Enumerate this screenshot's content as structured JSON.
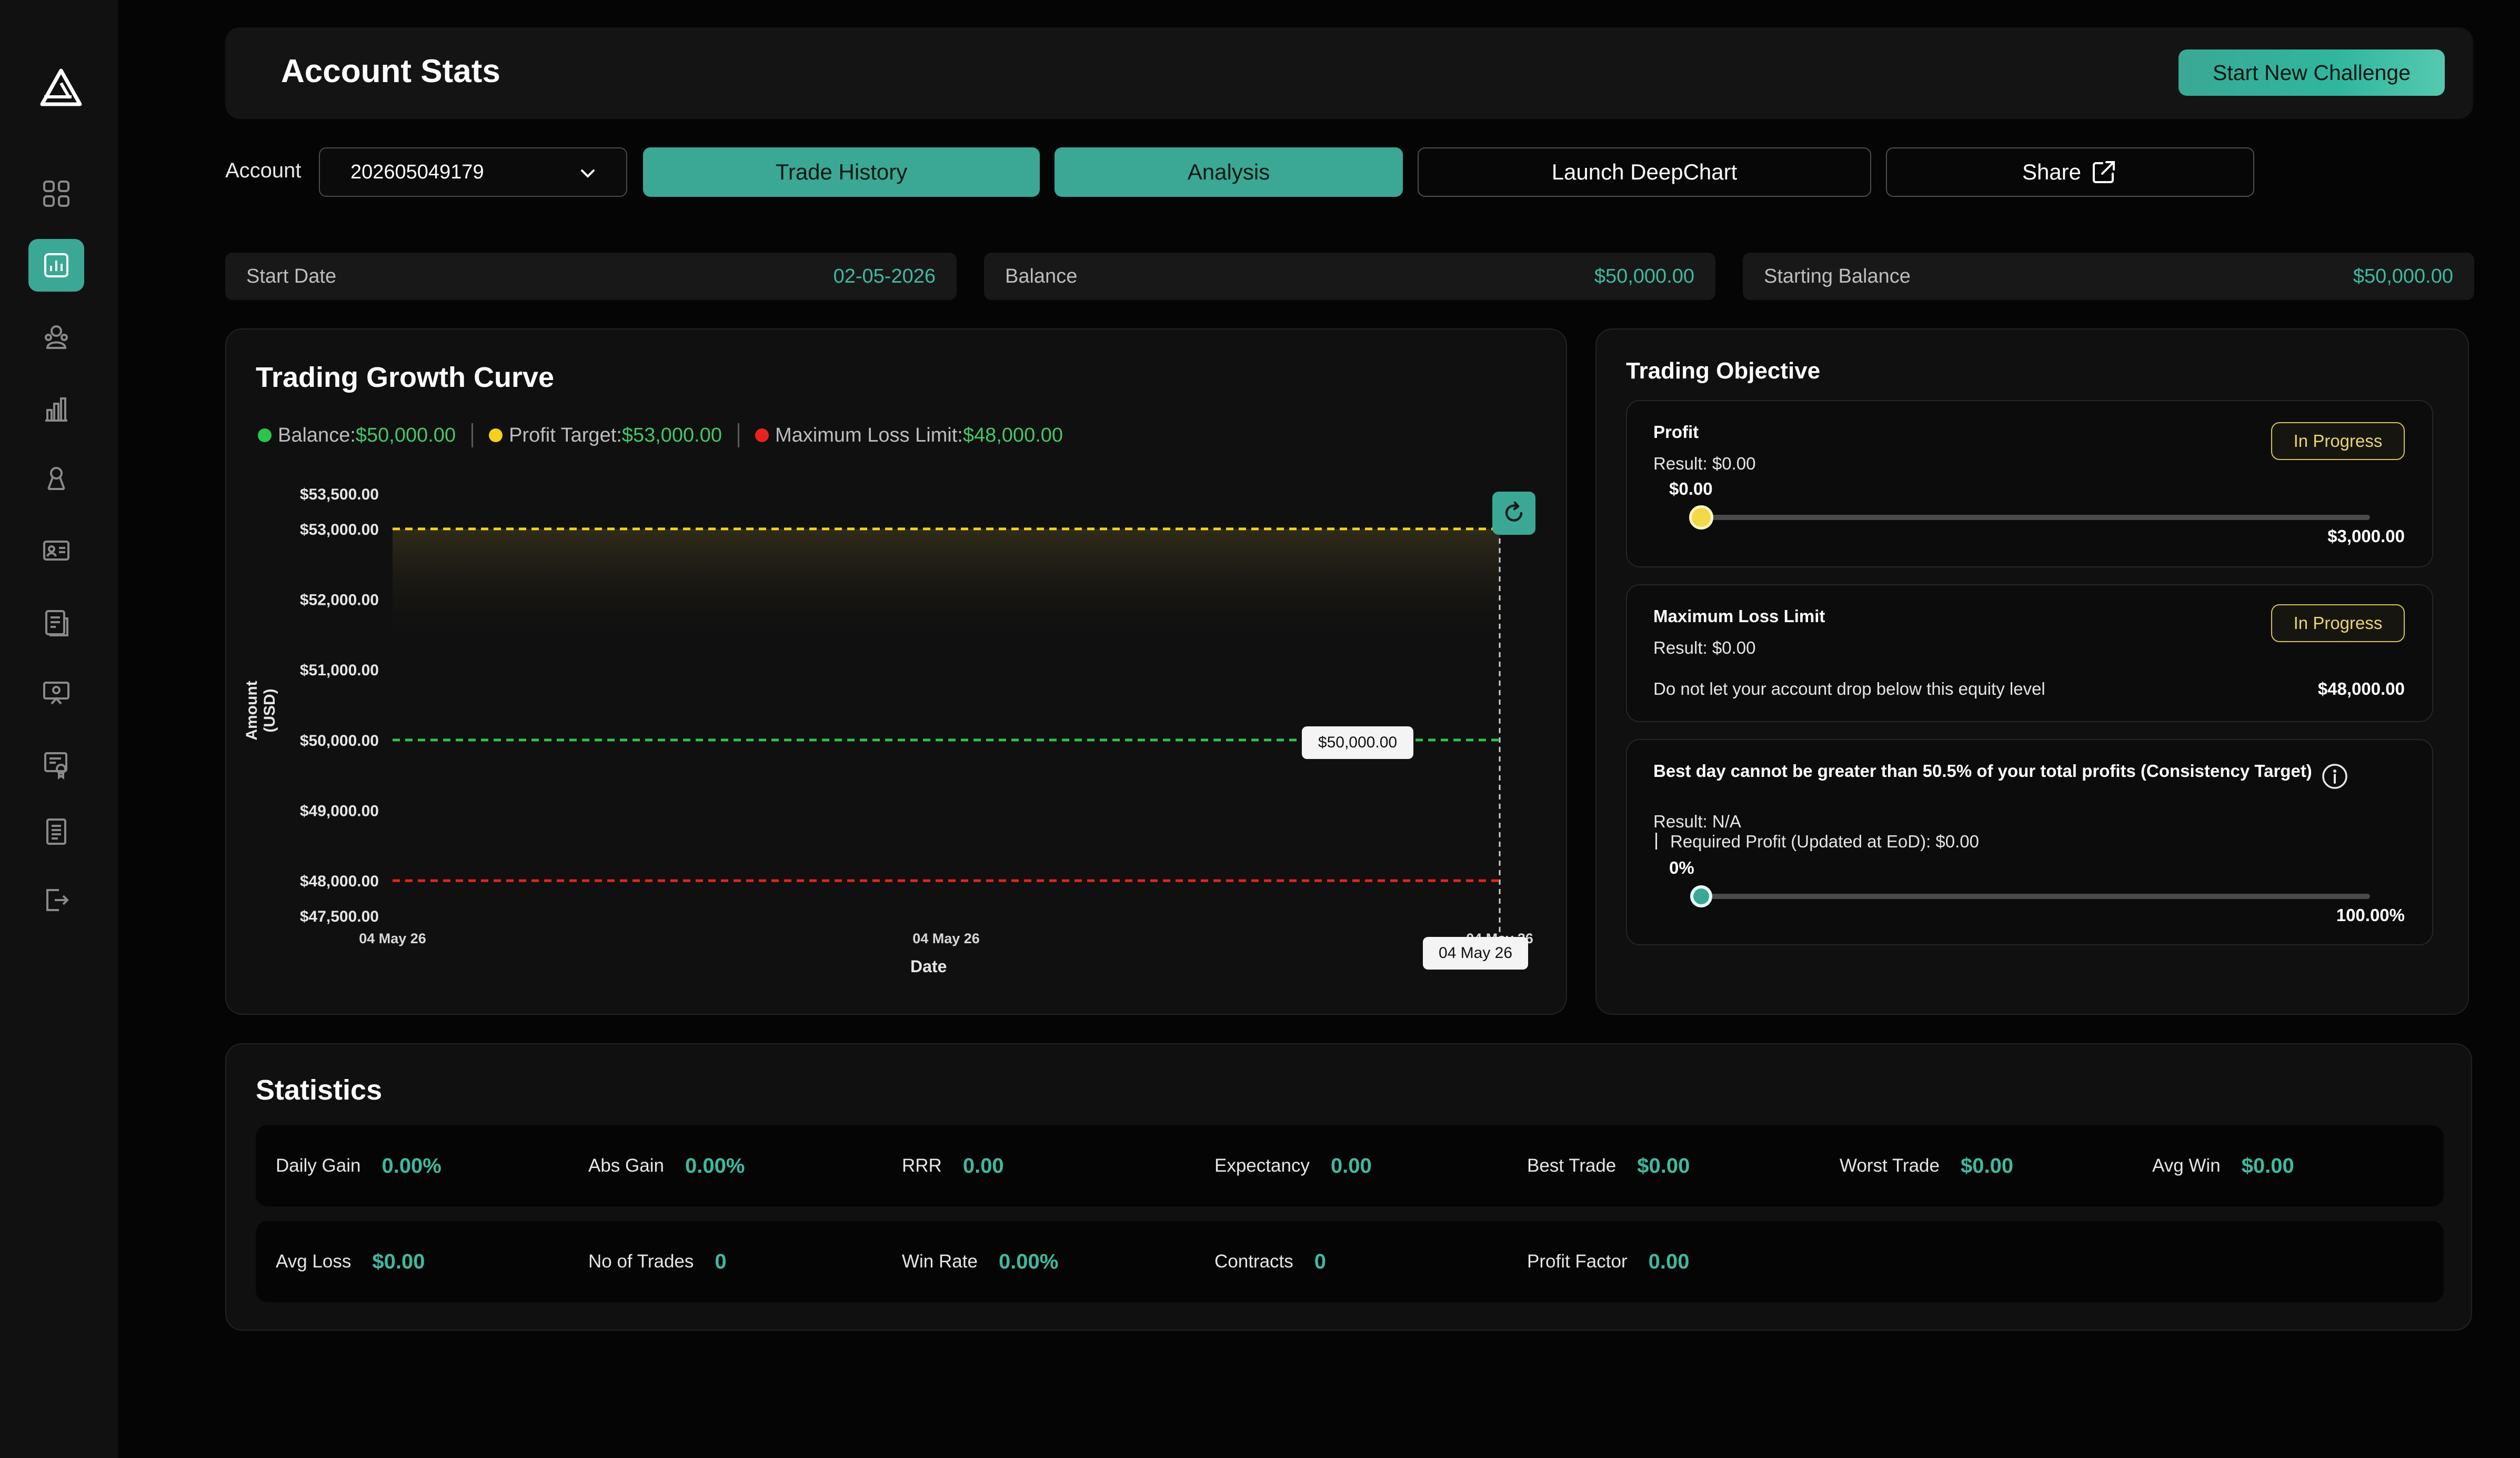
{
  "header": {
    "title": "Account Stats",
    "new_challenge_label": "Start New Challenge"
  },
  "toolbar": {
    "account_label": "Account",
    "account_value": "202605049179",
    "trade_history_label": "Trade History",
    "analysis_label": "Analysis",
    "deepchart_label": "Launch DeepChart",
    "share_label": "Share"
  },
  "info": {
    "start_date_label": "Start Date",
    "start_date_value": "02-05-2026",
    "balance_label": "Balance",
    "balance_value": "$50,000.00",
    "starting_balance_label": "Starting Balance",
    "starting_balance_value": "$50,000.00"
  },
  "growth": {
    "title": "Trading Growth Curve",
    "legend": [
      {
        "label": "Balance:",
        "value": "$50,000.00",
        "color": "#2ec44c"
      },
      {
        "label": "Profit Target:",
        "value": "$53,000.00",
        "color": "#f2d21c"
      },
      {
        "label": "Maximum Loss Limit:",
        "value": "$48,000.00",
        "color": "#e8231f"
      }
    ],
    "balance_tooltip": "$50,000.00",
    "date_tooltip": "04 May 26"
  },
  "chart_data": {
    "type": "line",
    "title": "Trading Growth Curve",
    "xlabel": "Date",
    "ylabel": "Amount (USD)",
    "ylim": [
      47500,
      53500
    ],
    "y_ticks": [
      {
        "value": 53500,
        "label": "$53,500.00"
      },
      {
        "value": 53000,
        "label": "$53,000.00"
      },
      {
        "value": 52000,
        "label": "$52,000.00"
      },
      {
        "value": 51000,
        "label": "$51,000.00"
      },
      {
        "value": 50000,
        "label": "$50,000.00"
      },
      {
        "value": 49000,
        "label": "$49,000.00"
      },
      {
        "value": 48000,
        "label": "$48,000.00"
      },
      {
        "value": 47500,
        "label": "$47,500.00"
      }
    ],
    "x_ticks": [
      "04 May 26",
      "04 May 26",
      "04 May 26"
    ],
    "series": [
      {
        "name": "Balance",
        "values": [
          50000,
          50000
        ],
        "color": "#2ec44c"
      },
      {
        "name": "Profit Target",
        "values": [
          53000,
          53000
        ],
        "color": "#f2d21c"
      },
      {
        "name": "Maximum Loss Limit",
        "values": [
          48000,
          48000
        ],
        "color": "#e8231f"
      }
    ],
    "grid": false,
    "legend": "top-left"
  },
  "objective": {
    "title": "Trading Objective",
    "profit": {
      "title": "Profit",
      "badge": "In Progress",
      "result": "Result: $0.00",
      "current": "$0.00",
      "max": "$3,000.00",
      "progress": 0
    },
    "loss": {
      "title": "Maximum Loss Limit",
      "badge": "In Progress",
      "result": "Result: $0.00",
      "description": "Do not let your account drop below this equity level",
      "value": "$48,000.00"
    },
    "consistency": {
      "title": "Best day cannot be greater than 50.5% of your total profits (Consistency Target)",
      "result": "Result: N/A",
      "required": "Required Profit (Updated at EoD): $0.00",
      "current": "0%",
      "max": "100.00%",
      "progress": 0
    }
  },
  "statistics": {
    "title": "Statistics",
    "row1": [
      {
        "label": "Daily Gain",
        "value": "0.00%"
      },
      {
        "label": "Abs Gain",
        "value": "0.00%"
      },
      {
        "label": "RRR",
        "value": "0.00"
      },
      {
        "label": "Expectancy",
        "value": "0.00"
      },
      {
        "label": "Best Trade",
        "value": "$0.00"
      },
      {
        "label": "Worst Trade",
        "value": "$0.00"
      },
      {
        "label": "Avg Win",
        "value": "$0.00"
      }
    ],
    "row2": [
      {
        "label": "Avg Loss",
        "value": "$0.00"
      },
      {
        "label": "No of Trades",
        "value": "0"
      },
      {
        "label": "Win Rate",
        "value": "0.00%"
      },
      {
        "label": "Contracts",
        "value": "0"
      },
      {
        "label": "Profit Factor",
        "value": "0.00"
      }
    ]
  },
  "colors": {
    "accent": "#3aa895",
    "value_green": "#3fb99f",
    "badge_yellow": "#e9d66a"
  },
  "sidebar_icons": [
    "logo-icon",
    "dashboard-grid-icon",
    "stats-icon",
    "traders-icon",
    "bar-chart-icon",
    "affiliate-icon",
    "id-card-icon",
    "documents-icon",
    "presentation-icon",
    "certificate-icon",
    "reports-icon",
    "logout-icon"
  ]
}
